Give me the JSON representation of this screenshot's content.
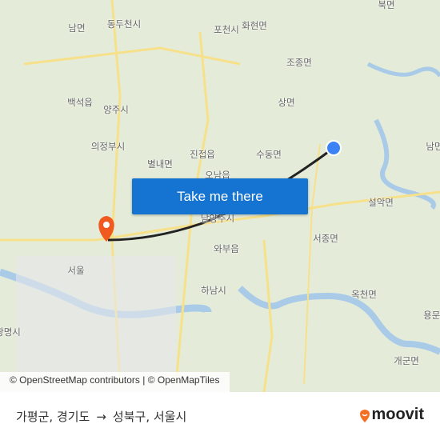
{
  "map": {
    "labels": [
      "북면",
      "남면",
      "동두천시",
      "포천시",
      "화현면",
      "조종면",
      "백석읍",
      "양주시",
      "상면",
      "의정부시",
      "진접읍",
      "수동면",
      "별내면",
      "오남읍",
      "남면",
      "설악면",
      "남양주시",
      "서종면",
      "와부읍",
      "서울",
      "하남시",
      "옥천면",
      "용문면",
      "개군면",
      "광명시"
    ],
    "attribution": "© OpenStreetMap contributors | © OpenMapTiles",
    "cta_label": "Take me there",
    "colors": {
      "land": "#e4ecd9",
      "water": "#a9cbe8",
      "road": "#f7e08a",
      "route": "#222222",
      "origin": "#3b82f6",
      "destination": "#f05a1f",
      "button": "#1573d1"
    }
  },
  "footer": {
    "origin": "가평군, 경기도",
    "arrow": "→",
    "destination": "성북구, 서울시",
    "brand": "moovit"
  }
}
